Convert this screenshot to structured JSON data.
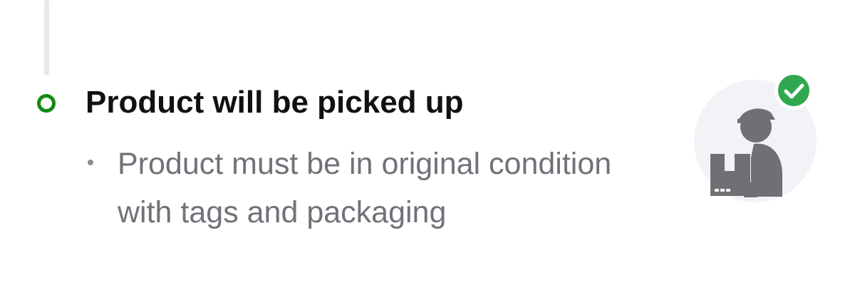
{
  "step": {
    "title": "Product will be picked up",
    "status_color": "#138a12",
    "details": [
      "Product must be in original condition with tags and packaging"
    ]
  },
  "illustration": {
    "icon": "delivery-person-icon",
    "badge_icon": "check-badge-icon",
    "badge_color": "#2fa84f",
    "figure_color": "#6f7073"
  }
}
